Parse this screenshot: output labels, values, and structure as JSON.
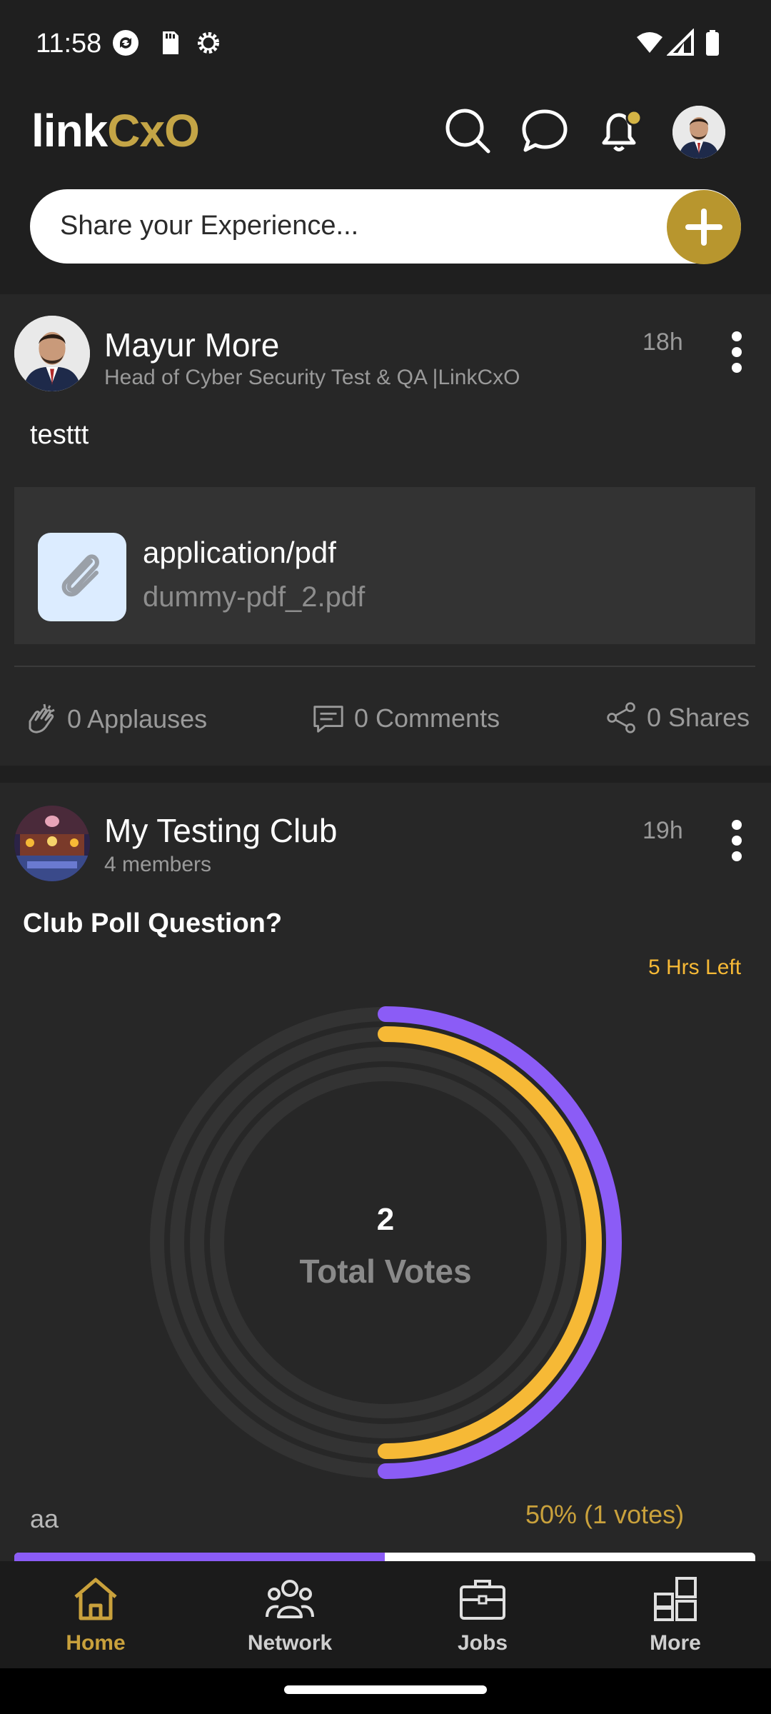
{
  "status_bar": {
    "time": "11:58"
  },
  "header": {
    "logo_left": "link",
    "logo_right": "CxO",
    "icons": [
      "search-icon",
      "chat-icon",
      "bell-icon",
      "profile-avatar"
    ],
    "share_placeholder": "Share your Experience..."
  },
  "post1": {
    "author": "Mayur More",
    "headline": "Head of Cyber Security Test & QA |LinkCxO",
    "time": "18h",
    "text": "testtt",
    "attachment": {
      "mime": "application/pdf",
      "file": "dummy-pdf_2.pdf"
    },
    "stats": {
      "applauses": "0 Applauses",
      "comments": "0 Comments",
      "shares": "0 Shares"
    }
  },
  "post2": {
    "club": "My Testing Club",
    "members": "4 members",
    "time": "19h",
    "question": "Club Poll Question?",
    "time_left": "5 Hrs Left",
    "total_votes": "2",
    "total_votes_label": "Total Votes",
    "options": [
      {
        "label": "aa",
        "result": "50% (1 votes)",
        "fraction": 0.5
      }
    ],
    "ring_fractions": [
      0.5,
      0.5
    ],
    "colors": {
      "purple": "#8b5cf6",
      "yellow": "#f6b936",
      "track": "#333333"
    }
  },
  "bottom_nav": {
    "items": [
      {
        "label": "Home",
        "active": true
      },
      {
        "label": "Network",
        "active": false
      },
      {
        "label": "Jobs",
        "active": false
      },
      {
        "label": "More",
        "active": false
      }
    ]
  }
}
